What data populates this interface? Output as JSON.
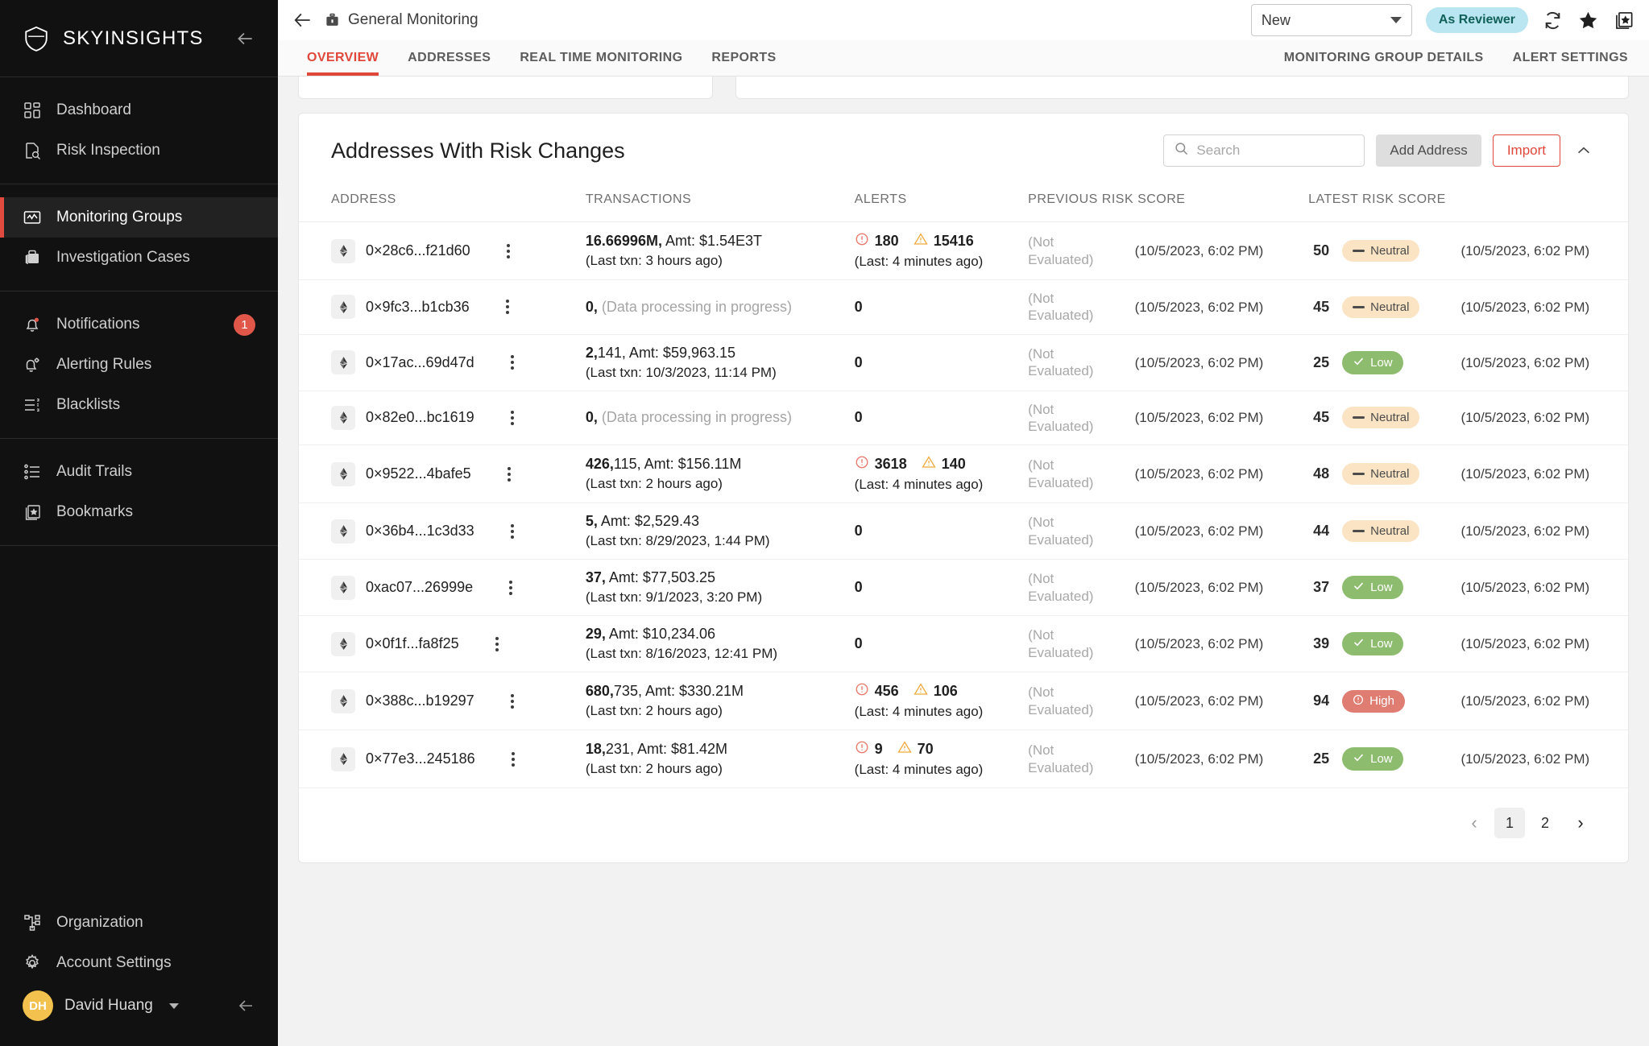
{
  "sidebar": {
    "brand": "SKYINSIGHTS",
    "groups": [
      {
        "items": [
          {
            "label": "Dashboard",
            "icon": "dashboard-icon",
            "active": false
          },
          {
            "label": "Risk Inspection",
            "icon": "risk-inspection-icon",
            "active": false
          }
        ]
      },
      {
        "items": [
          {
            "label": "Monitoring Groups",
            "icon": "monitoring-groups-icon",
            "active": true
          },
          {
            "label": "Investigation Cases",
            "icon": "investigation-cases-icon",
            "active": false
          }
        ]
      },
      {
        "items": [
          {
            "label": "Notifications",
            "icon": "bell-icon",
            "active": false,
            "badge": "1"
          },
          {
            "label": "Alerting Rules",
            "icon": "bell-gear-icon",
            "active": false
          },
          {
            "label": "Blacklists",
            "icon": "list-icon",
            "active": false
          }
        ]
      },
      {
        "items": [
          {
            "label": "Audit Trails",
            "icon": "audit-trails-icon",
            "active": false
          },
          {
            "label": "Bookmarks",
            "icon": "bookmarks-icon",
            "active": false
          }
        ]
      }
    ],
    "bottom_items": [
      {
        "label": "Organization",
        "icon": "organization-icon"
      },
      {
        "label": "Account Settings",
        "icon": "gear-icon"
      }
    ],
    "user": {
      "initials": "DH",
      "name": "David Huang"
    }
  },
  "topbar": {
    "breadcrumb": "General Monitoring",
    "status_select": "New",
    "role_chip": "As Reviewer"
  },
  "tabs": {
    "left": [
      {
        "label": "OVERVIEW",
        "active": true
      },
      {
        "label": "ADDRESSES",
        "active": false
      },
      {
        "label": "REAL TIME MONITORING",
        "active": false
      },
      {
        "label": "REPORTS",
        "active": false
      }
    ],
    "right": [
      {
        "label": "MONITORING GROUP DETAILS"
      },
      {
        "label": "ALERT SETTINGS"
      }
    ]
  },
  "card": {
    "title": "Addresses With Risk Changes",
    "search_placeholder": "Search",
    "search_value": "",
    "add_address_label": "Add Address",
    "import_label": "Import",
    "columns": [
      "ADDRESS",
      "TRANSACTIONS",
      "ALERTS",
      "PREVIOUS RISK SCORE",
      "LATEST RISK SCORE"
    ],
    "rows": [
      {
        "address": "0×28c6...f21d60",
        "chain": "ethereum-icon",
        "tx_main": "16.66996M,  Amt: $1.54E3T",
        "tx_sub": "(Last txn: 3 hours ago)",
        "tx_processing": false,
        "alert_critical": "180",
        "alert_warning": "15416",
        "alert_sub": "(Last: 4 minutes ago)",
        "alert_zero": false,
        "previous_score": "(Not Evaluated)",
        "previous_date": "(10/5/2023, 6:02 PM)",
        "latest_score": "50",
        "latest_level": "Neutral",
        "latest_date": "(10/5/2023, 6:02 PM)"
      },
      {
        "address": "0×9fc3...b1cb36",
        "chain": "ethereum-icon",
        "tx_main": "0,",
        "tx_sub": "(Data processing in progress)",
        "tx_processing": true,
        "alert_critical": "",
        "alert_warning": "",
        "alert_sub": "",
        "alert_zero": true,
        "previous_score": "(Not Evaluated)",
        "previous_date": "(10/5/2023, 6:02 PM)",
        "latest_score": "45",
        "latest_level": "Neutral",
        "latest_date": "(10/5/2023, 6:02 PM)"
      },
      {
        "address": "0×17ac...69d47d",
        "chain": "ethereum-icon",
        "tx_main": "2,141,  Amt: $59,963.15",
        "tx_sub": "(Last txn: 10/3/2023, 11:14 PM)",
        "tx_processing": false,
        "alert_critical": "",
        "alert_warning": "",
        "alert_sub": "",
        "alert_zero": true,
        "previous_score": "(Not Evaluated)",
        "previous_date": "(10/5/2023, 6:02 PM)",
        "latest_score": "25",
        "latest_level": "Low",
        "latest_date": "(10/5/2023, 6:02 PM)"
      },
      {
        "address": "0×82e0...bc1619",
        "chain": "ethereum-icon",
        "tx_main": "0,",
        "tx_sub": "(Data processing in progress)",
        "tx_processing": true,
        "alert_critical": "",
        "alert_warning": "",
        "alert_sub": "",
        "alert_zero": true,
        "previous_score": "(Not Evaluated)",
        "previous_date": "(10/5/2023, 6:02 PM)",
        "latest_score": "45",
        "latest_level": "Neutral",
        "latest_date": "(10/5/2023, 6:02 PM)"
      },
      {
        "address": "0×9522...4bafe5",
        "chain": "ethereum-icon",
        "tx_main": "426,115,  Amt: $156.11M",
        "tx_sub": "(Last txn: 2 hours ago)",
        "tx_processing": false,
        "alert_critical": "3618",
        "alert_warning": "140",
        "alert_sub": "(Last: 4 minutes ago)",
        "alert_zero": false,
        "previous_score": "(Not Evaluated)",
        "previous_date": "(10/5/2023, 6:02 PM)",
        "latest_score": "48",
        "latest_level": "Neutral",
        "latest_date": "(10/5/2023, 6:02 PM)"
      },
      {
        "address": "0×36b4...1c3d33",
        "chain": "ethereum-icon",
        "tx_main": "5,  Amt: $2,529.43",
        "tx_sub": "(Last txn: 8/29/2023, 1:44 PM)",
        "tx_processing": false,
        "alert_critical": "",
        "alert_warning": "",
        "alert_sub": "",
        "alert_zero": true,
        "previous_score": "(Not Evaluated)",
        "previous_date": "(10/5/2023, 6:02 PM)",
        "latest_score": "44",
        "latest_level": "Neutral",
        "latest_date": "(10/5/2023, 6:02 PM)"
      },
      {
        "address": "0xac07...26999e",
        "chain": "ethereum-icon",
        "tx_main": "37,  Amt: $77,503.25",
        "tx_sub": "(Last txn: 9/1/2023, 3:20 PM)",
        "tx_processing": false,
        "alert_critical": "",
        "alert_warning": "",
        "alert_sub": "",
        "alert_zero": true,
        "previous_score": "(Not Evaluated)",
        "previous_date": "(10/5/2023, 6:02 PM)",
        "latest_score": "37",
        "latest_level": "Low",
        "latest_date": "(10/5/2023, 6:02 PM)"
      },
      {
        "address": "0×0f1f...fa8f25",
        "chain": "ethereum-icon",
        "tx_main": "29,  Amt: $10,234.06",
        "tx_sub": "(Last txn: 8/16/2023, 12:41 PM)",
        "tx_processing": false,
        "alert_critical": "",
        "alert_warning": "",
        "alert_sub": "",
        "alert_zero": true,
        "previous_score": "(Not Evaluated)",
        "previous_date": "(10/5/2023, 6:02 PM)",
        "latest_score": "39",
        "latest_level": "Low",
        "latest_date": "(10/5/2023, 6:02 PM)"
      },
      {
        "address": "0×388c...b19297",
        "chain": "ethereum-icon",
        "tx_main": "680,735,  Amt: $330.21M",
        "tx_sub": "(Last txn: 2 hours ago)",
        "tx_processing": false,
        "alert_critical": "456",
        "alert_warning": "106",
        "alert_sub": "(Last: 4 minutes ago)",
        "alert_zero": false,
        "previous_score": "(Not Evaluated)",
        "previous_date": "(10/5/2023, 6:02 PM)",
        "latest_score": "94",
        "latest_level": "High",
        "latest_date": "(10/5/2023, 6:02 PM)"
      },
      {
        "address": "0×77e3...245186",
        "chain": "ethereum-icon",
        "tx_main": "18,231,  Amt: $81.42M",
        "tx_sub": "(Last txn: 2 hours ago)",
        "tx_processing": false,
        "alert_critical": "9",
        "alert_warning": "70",
        "alert_sub": "(Last: 4 minutes ago)",
        "alert_zero": false,
        "previous_score": "(Not Evaluated)",
        "previous_date": "(10/5/2023, 6:02 PM)",
        "latest_score": "25",
        "latest_level": "Low",
        "latest_date": "(10/5/2023, 6:02 PM)"
      }
    ],
    "pagination": {
      "prev": "‹",
      "next": "›",
      "pages": [
        "1",
        "2"
      ],
      "current": "1"
    }
  },
  "colors": {
    "accent_red": "#e0473a",
    "sidebar_bg": "#111111",
    "pill_neutral_bg": "#fae4c4",
    "pill_low_bg": "#8dbc6e",
    "pill_high_bg": "#df7d72",
    "avatar_bg": "#f2c14e",
    "chip_reviewer_bg": "#b9e6f0"
  }
}
